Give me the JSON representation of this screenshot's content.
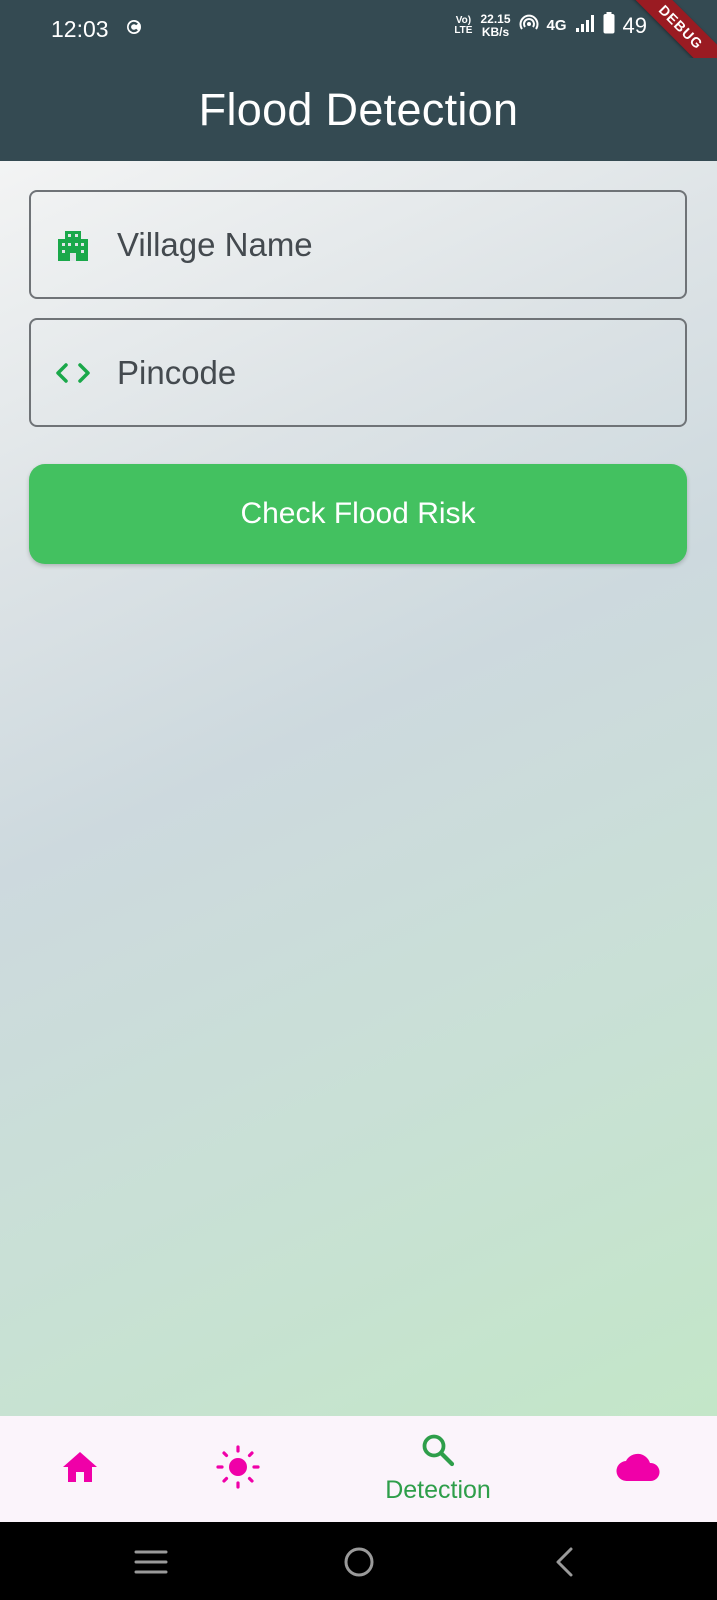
{
  "status_bar": {
    "time": "12:03",
    "volte_top": "Vo)",
    "volte_bottom": "LTE",
    "speed_value": "22.15",
    "speed_unit": "KB/s",
    "network": "4G",
    "battery": "49",
    "debug_ribbon": "DEBUG"
  },
  "app_bar": {
    "title": "Flood Detection"
  },
  "form": {
    "village_placeholder": "Village Name",
    "pincode_placeholder": "Pincode",
    "submit_label": "Check Flood Risk"
  },
  "bottom_nav": {
    "items": [
      {
        "icon": "home-icon",
        "label": ""
      },
      {
        "icon": "sun-icon",
        "label": ""
      },
      {
        "icon": "search-icon",
        "label": "Detection",
        "active": true
      },
      {
        "icon": "cloud-icon",
        "label": ""
      }
    ]
  },
  "colors": {
    "app_bar": "#344a52",
    "accent_green": "#43c160",
    "icon_green": "#1aa84a",
    "nav_magenta": "#f000a8",
    "nav_active": "#2e9e4a"
  }
}
